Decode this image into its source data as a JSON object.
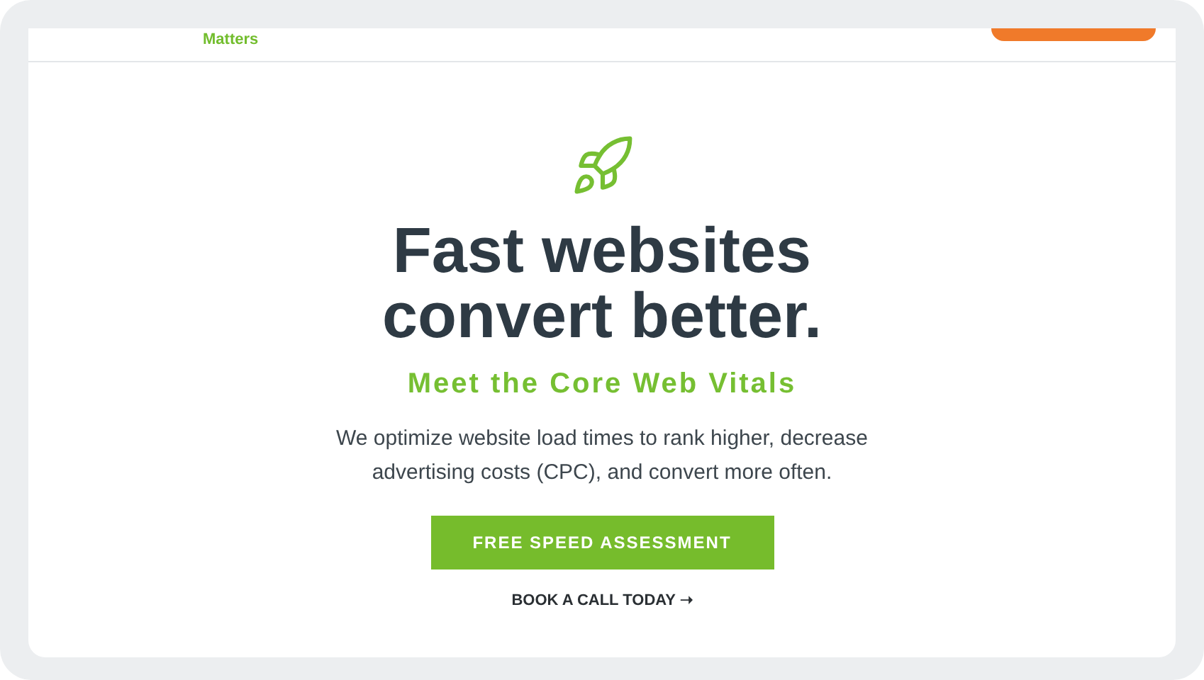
{
  "header": {
    "logo_tagline": "Matters"
  },
  "hero": {
    "headline_lines": [
      "Fast websites",
      "convert better."
    ],
    "subheading": "Meet the Core Web Vitals",
    "description": "We optimize website load times to rank higher, decrease advertising costs (CPC), and convert more often.",
    "primary_button": "FREE SPEED ASSESSMENT",
    "secondary_link": "BOOK A CALL TODAY ➝"
  }
}
